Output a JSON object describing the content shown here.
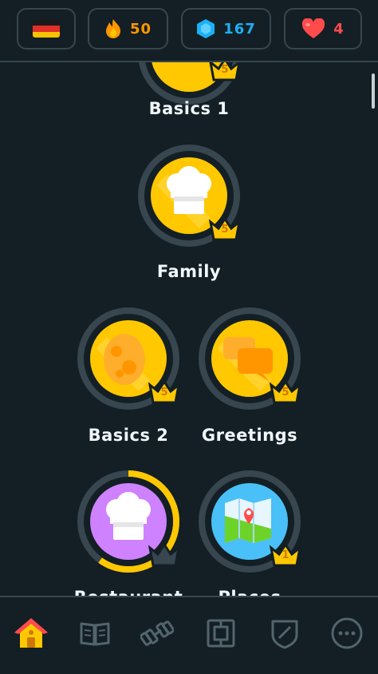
{
  "stats": {
    "language_flag": "germany-flag",
    "streak": "50",
    "gems": "167",
    "hearts": "4"
  },
  "colors": {
    "background": "#131f24",
    "border": "#37464f",
    "gold": "#ffc800",
    "streak": "#ff9600",
    "gems": "#1cb0f6",
    "hearts": "#ff4b4b",
    "purple": "#ce82ff",
    "blue": "#49c0f8"
  },
  "skills": [
    {
      "name": "Basics 1",
      "crown_level": "5",
      "icon": "egg-icon"
    },
    {
      "name": "Family",
      "crown_level": "5",
      "icon": "chef-hat-icon"
    },
    {
      "name": "Basics 2",
      "crown_level": "5",
      "icon": "egg-icon"
    },
    {
      "name": "Greetings",
      "crown_level": "5",
      "icon": "speech-bubbles-icon"
    },
    {
      "name": "Restaurant",
      "crown_level": "",
      "progress": 0.6,
      "icon": "chef-hat-icon"
    },
    {
      "name": "Places",
      "crown_level": "1",
      "icon": "map-icon"
    }
  ],
  "nav": [
    {
      "name": "home",
      "icon": "home-icon",
      "active": true
    },
    {
      "name": "stories",
      "icon": "book-icon"
    },
    {
      "name": "practice",
      "icon": "dumbbell-icon"
    },
    {
      "name": "leaderboard",
      "icon": "leaderboard-icon"
    },
    {
      "name": "shield",
      "icon": "shield-icon"
    },
    {
      "name": "more",
      "icon": "more-icon"
    }
  ]
}
